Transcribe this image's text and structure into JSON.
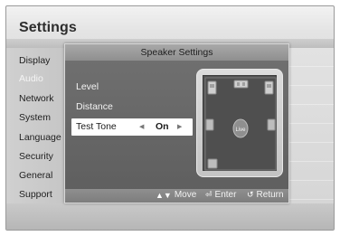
{
  "page": {
    "title": "Settings"
  },
  "sidebar": {
    "items": [
      {
        "label": "Display"
      },
      {
        "label": "Audio"
      },
      {
        "label": "Network"
      },
      {
        "label": "System"
      },
      {
        "label": "Language"
      },
      {
        "label": "Security"
      },
      {
        "label": "General"
      },
      {
        "label": "Support"
      }
    ],
    "active_index": 1
  },
  "dialog": {
    "title": "Speaker Settings",
    "menu": [
      {
        "label": "Level"
      },
      {
        "label": "Distance"
      },
      {
        "label": "Test Tone"
      }
    ],
    "selected_index": 2,
    "test_tone": {
      "value": "On"
    },
    "diagram": {
      "center_label": "Live"
    },
    "footer": {
      "move_label": "Move",
      "enter_label": "Enter",
      "return_label": "Return"
    }
  }
}
